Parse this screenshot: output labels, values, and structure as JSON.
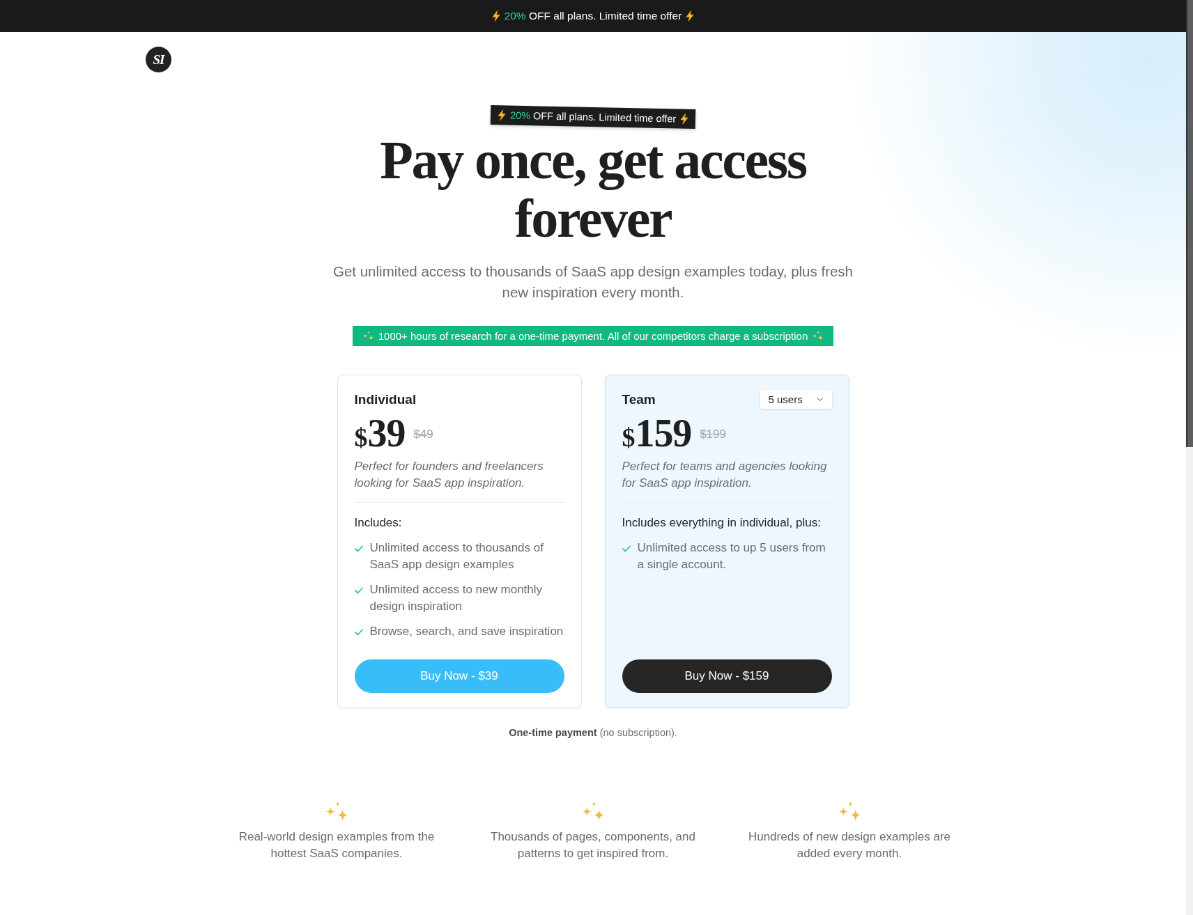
{
  "announcement_bar": {
    "highlight": "20%",
    "text": "OFF all plans. Limited time offer"
  },
  "logo": {
    "text": "SI"
  },
  "hero": {
    "badge": {
      "highlight": "20%",
      "text": "OFF all plans. Limited time offer"
    },
    "title": "Pay once, get access forever",
    "subtitle": "Get unlimited access to thousands of SaaS app design examples today, plus fresh new inspiration every month.",
    "banner": "1000+ hours of research for a one-time payment. All of our competitors charge a subscription"
  },
  "plans": [
    {
      "name": "Individual",
      "highlighted": false,
      "currency": "$",
      "price": "39",
      "old_price": "$49",
      "description": "Perfect for founders and freelancers looking for SaaS app inspiration.",
      "includes_label": "Includes:",
      "features": [
        "Unlimited access to thousands of SaaS app design examples",
        "Unlimited access to new monthly design inspiration",
        "Browse, search, and save inspiration"
      ],
      "button": "Buy Now - $39"
    },
    {
      "name": "Team",
      "highlighted": true,
      "seat_select": {
        "value": "5 users"
      },
      "currency": "$",
      "price": "159",
      "old_price": "$199",
      "description": "Perfect for teams and agencies looking for SaaS app inspiration.",
      "includes_label": "Includes everything in individual, plus:",
      "features": [
        "Unlimited access to up 5 users from a single account."
      ],
      "button": "Buy Now - $159"
    }
  ],
  "payment_note": "**One-time payment** (no subscription).",
  "benefits": [
    "Real-world design examples from the hottest SaaS companies.",
    "Thousands of pages, components, and patterns to get inspired from.",
    "Hundreds of new design examples are added every month."
  ]
}
